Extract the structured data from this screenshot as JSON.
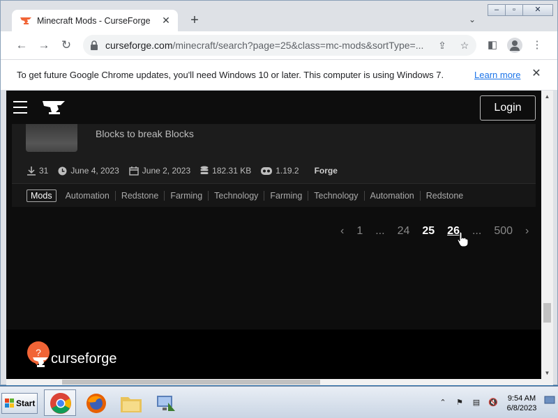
{
  "browser": {
    "tab_title": "Minecraft Mods - CurseForge",
    "url_host": "curseforge.com",
    "url_path": "/minecraft/search?page=25&class=mc-mods&sortType=...",
    "infobar_text": "To get future Google Chrome updates, you'll need Windows 10 or later. This computer is using Windows 7.",
    "infobar_link": "Learn more"
  },
  "site": {
    "login_label": "Login",
    "footer_brand": "curseforge",
    "help_icon_glyph": "?"
  },
  "mod_card": {
    "description": "Blocks to break Blocks",
    "downloads": "31",
    "updated": "June 4, 2023",
    "created": "June 2, 2023",
    "size": "182.31 KB",
    "game_version": "1.19.2",
    "loader": "Forge",
    "tags": [
      "Mods",
      "Automation",
      "Redstone",
      "Farming",
      "Technology",
      "Farming",
      "Technology",
      "Automation",
      "Redstone"
    ]
  },
  "pagination": {
    "prev": "‹",
    "next": "›",
    "pages": [
      "1",
      "...",
      "24",
      "25",
      "26",
      "...",
      "500"
    ],
    "current": "25",
    "hovered": "26"
  },
  "taskbar": {
    "start_label": "Start",
    "time": "9:54 AM",
    "date": "6/8/2023"
  },
  "colors": {
    "accent": "#f16436",
    "page_bg": "#0d0d0d",
    "card_bg": "#1c1c1c"
  }
}
